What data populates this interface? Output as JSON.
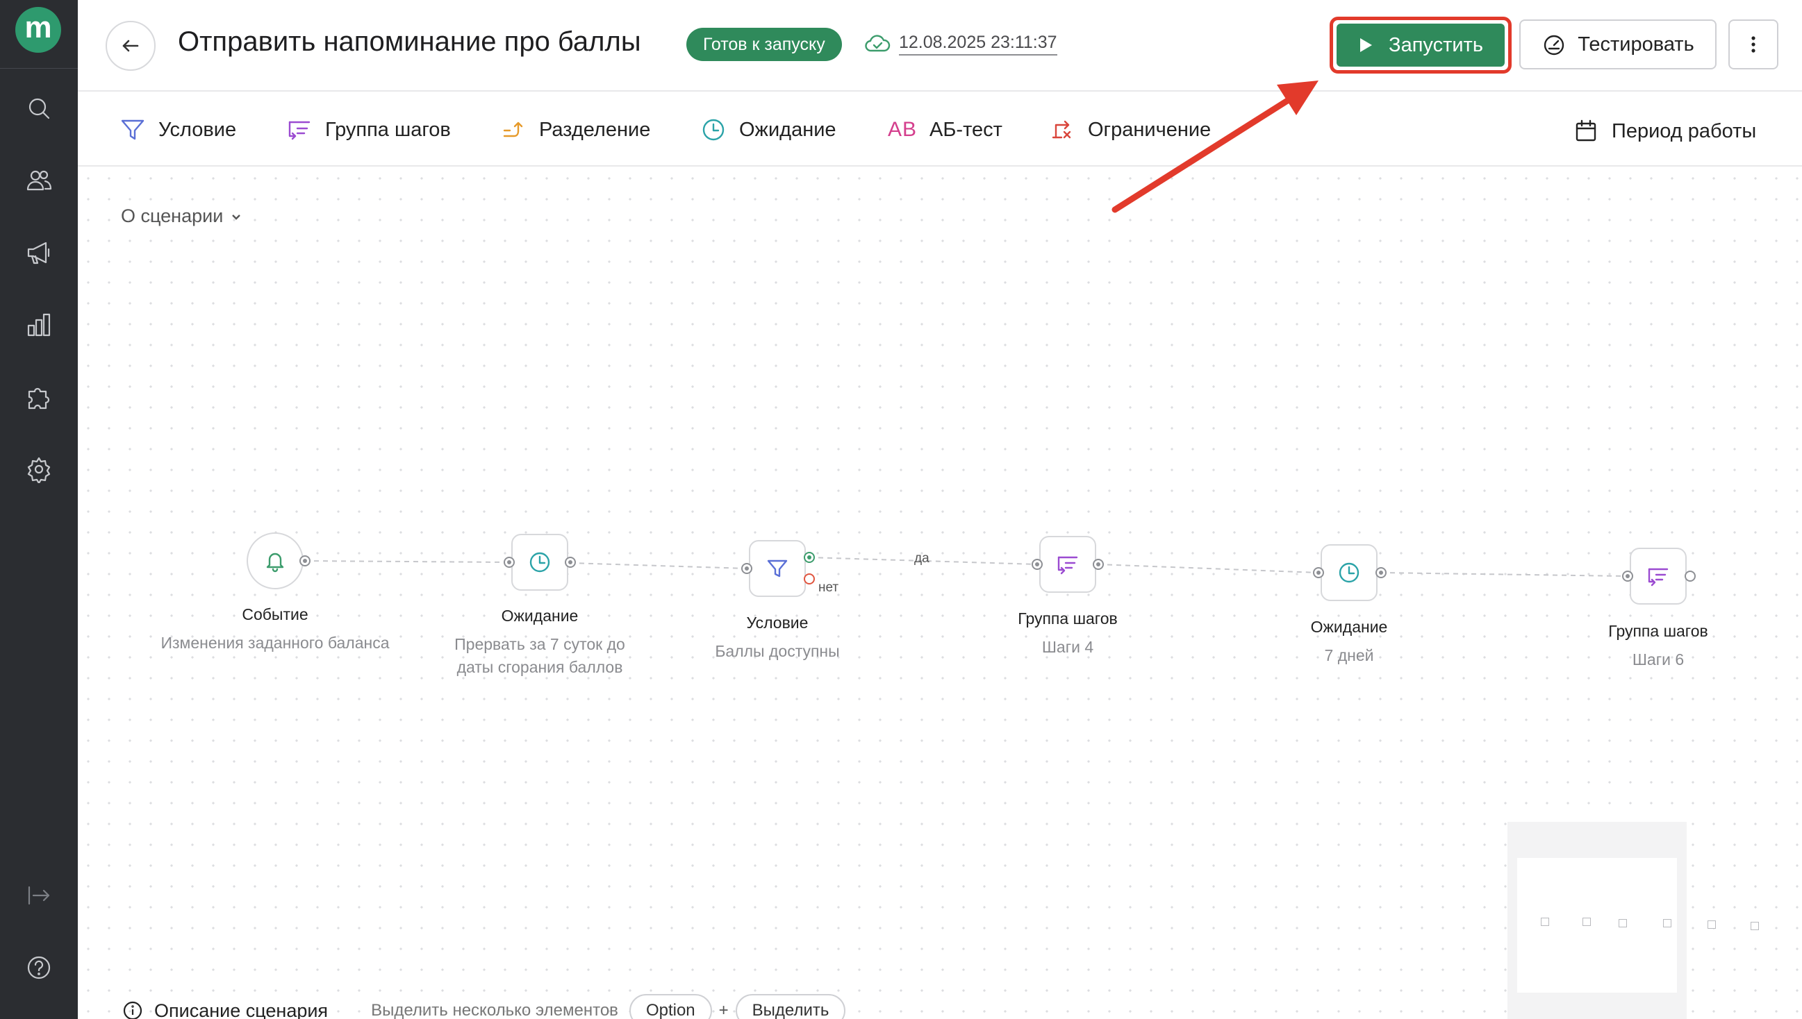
{
  "sidebar": {
    "logo": "m",
    "items": [
      {
        "name": "search-icon"
      },
      {
        "name": "users-icon"
      },
      {
        "name": "megaphone-icon"
      },
      {
        "name": "chart-icon"
      },
      {
        "name": "puzzle-icon"
      },
      {
        "name": "gear-icon"
      },
      {
        "name": "logout-icon"
      },
      {
        "name": "help-icon"
      }
    ]
  },
  "header": {
    "title": "Отправить напоминание про баллы",
    "status": "Готов к запуску",
    "saved_at": "12.08.2025 23:11:37",
    "launch_label": "Запустить",
    "test_label": "Тестировать"
  },
  "toolbar": {
    "items": [
      {
        "label": "Условие",
        "icon": "filter-icon",
        "color": "#5a6fd6"
      },
      {
        "label": "Группа шагов",
        "icon": "group-steps-icon",
        "color": "#9b4bd1"
      },
      {
        "label": "Разделение",
        "icon": "split-icon",
        "color": "#e69a2a"
      },
      {
        "label": "Ожидание",
        "icon": "clock-icon",
        "color": "#2ba3a8"
      },
      {
        "label": "АБ-тест",
        "icon": "ab-icon",
        "icon_text": "AB",
        "color": "#d43f8d"
      },
      {
        "label": "Ограничение",
        "icon": "limit-icon",
        "color": "#d9453b"
      }
    ],
    "period_label": "Период работы"
  },
  "canvas": {
    "about_label": "О сценарии",
    "nodes": [
      {
        "title": "Событие",
        "subtitle": "Изменения заданного баланса",
        "icon": "bell-icon"
      },
      {
        "title": "Ожидание",
        "subtitle": "Прервать за 7 суток до даты сгорания баллов",
        "icon": "clock-icon"
      },
      {
        "title": "Условие",
        "subtitle": "Баллы доступны",
        "icon": "filter-icon"
      },
      {
        "title": "Группа шагов",
        "subtitle": "Шаги 4",
        "icon": "group-steps-icon"
      },
      {
        "title": "Ожидание",
        "subtitle": "7 дней",
        "icon": "clock-icon"
      },
      {
        "title": "Группа шагов",
        "subtitle": "Шаги 6",
        "icon": "group-steps-icon"
      }
    ],
    "edge_labels": {
      "yes": "да",
      "no": "нет"
    }
  },
  "bottom": {
    "description_label": "Описание сценария",
    "hint": "Выделить несколько элементов",
    "key": "Option",
    "plus": "+",
    "select_label": "Выделить"
  },
  "colors": {
    "accent": "#2f8a5b",
    "highlight": "#e23a2b",
    "sidebar": "#2b2d31"
  }
}
